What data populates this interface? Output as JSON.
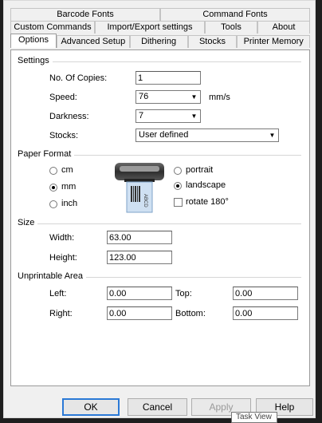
{
  "tabs": {
    "row1": [
      "Barcode Fonts",
      "Command Fonts"
    ],
    "row2": [
      "Custom Commands",
      "Import/Export settings",
      "Tools",
      "About"
    ],
    "row3": [
      "Options",
      "Advanced Setup",
      "Dithering",
      "Stocks",
      "Printer Memory"
    ],
    "selected": "Options"
  },
  "settings": {
    "title": "Settings",
    "copies_label": "No. Of Copies:",
    "copies_value": "1",
    "speed_label": "Speed:",
    "speed_value": "76",
    "speed_unit": "mm/s",
    "darkness_label": "Darkness:",
    "darkness_value": "7",
    "stocks_label": "Stocks:",
    "stocks_value": "User defined"
  },
  "paper_format": {
    "title": "Paper Format",
    "units": [
      "cm",
      "mm",
      "inch"
    ],
    "selected_unit": "mm",
    "orientations": [
      "portrait",
      "landscape"
    ],
    "selected_orientation": "landscape",
    "rotate_label": "rotate 180°",
    "rotate_checked": false,
    "label_sample_text": "ABCD"
  },
  "size": {
    "title": "Size",
    "width_label": "Width:",
    "width_value": "63.00",
    "height_label": "Height:",
    "height_value": "123.00"
  },
  "unprintable": {
    "title": "Unprintable Area",
    "left_label": "Left:",
    "left_value": "0.00",
    "top_label": "Top:",
    "top_value": "0.00",
    "right_label": "Right:",
    "right_value": "0.00",
    "bottom_label": "Bottom:",
    "bottom_value": "0.00"
  },
  "buttons": {
    "ok": "OK",
    "cancel": "Cancel",
    "apply": "Apply",
    "help": "Help"
  },
  "tooltip": "Task View",
  "colors": {
    "default_button_border": "#2b79d6",
    "window_bg": "#f0f0f0",
    "panel_bg": "#ffffff"
  }
}
